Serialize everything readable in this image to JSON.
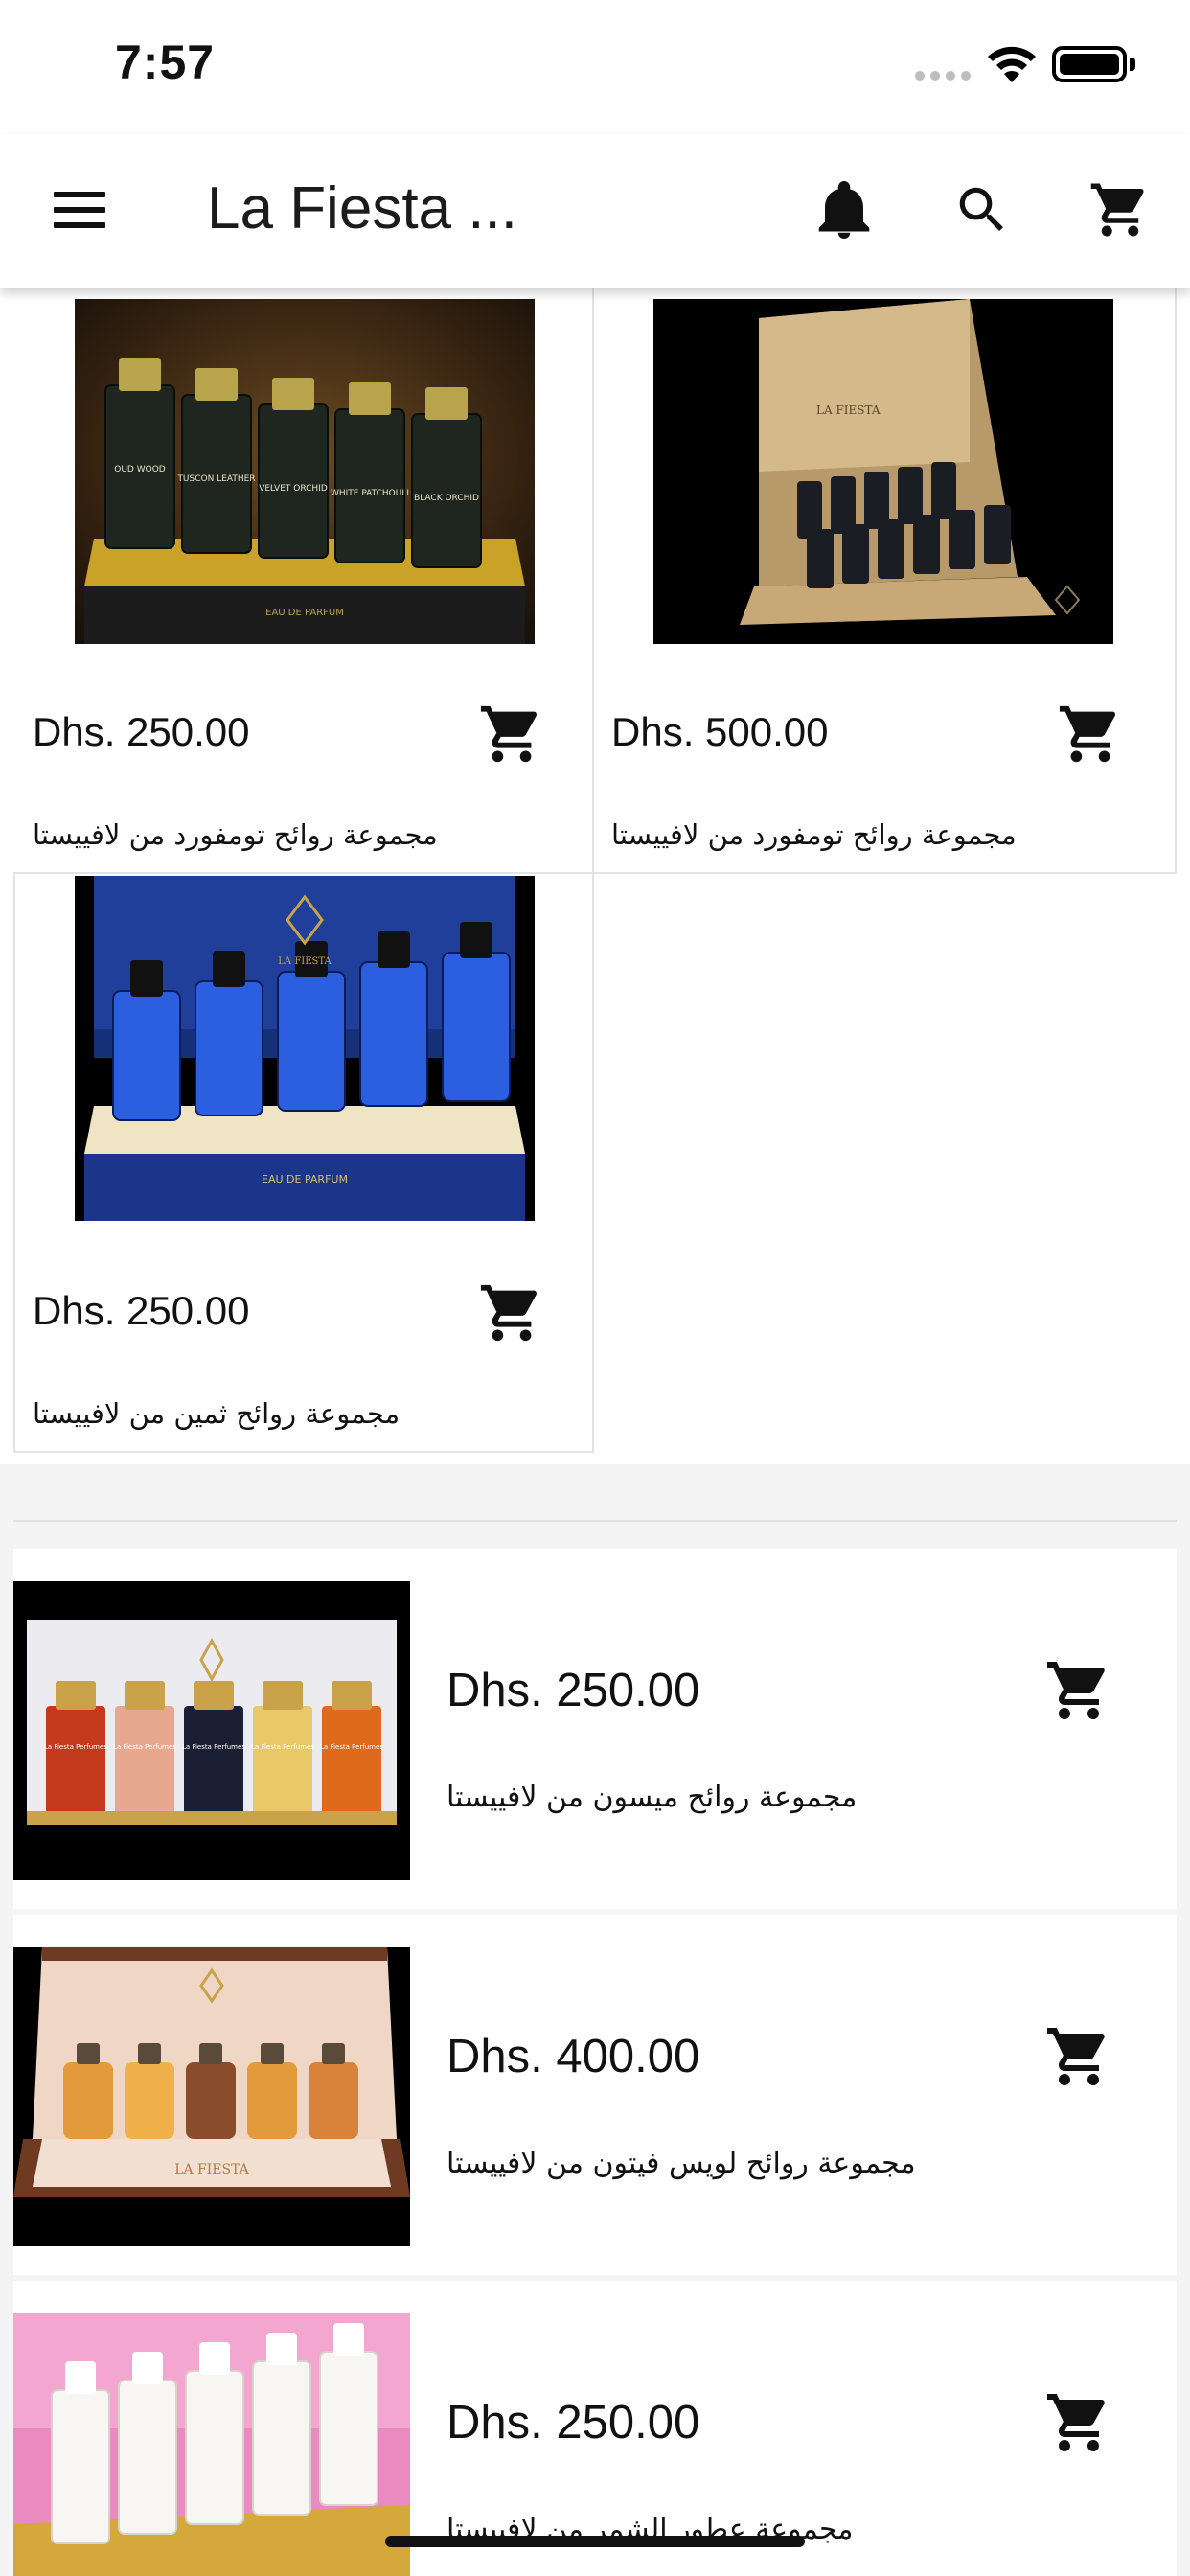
{
  "status_bar": {
    "time": "7:57"
  },
  "app_bar": {
    "title": "La Fiesta ..."
  },
  "grid_products": [
    {
      "price": "Dhs. 250.00",
      "name": "مجموعة روائح تومفورد من لافييستا",
      "bottle_labels": [
        "OUD WOOD",
        "TUSCON LEATHER",
        "VELVET ORCHID",
        "WHITE PATCHOULI",
        "BLACK ORCHID"
      ],
      "box_text": "EAU DE PARFUM"
    },
    {
      "price": "Dhs. 500.00",
      "name": "مجموعة روائح تومفورد من لافييستا",
      "brand_mark": "LA FIESTA"
    },
    {
      "price": "Dhs. 250.00",
      "name": "مجموعة روائح ثمين من لافييستا",
      "brand_mark": "LA FIESTA",
      "box_text": "EAU DE PARFUM"
    }
  ],
  "list_products": [
    {
      "price": "Dhs. 250.00",
      "name": "مجموعة روائح ميسون من لافييستا",
      "bottle_labels": [
        "La Fiesta Perfumes",
        "La Fiesta Perfumes",
        "La Fiesta Perfumes",
        "La Fiesta Perfumes",
        "La Fiesta Perfumes"
      ]
    },
    {
      "price": "Dhs. 400.00",
      "name": "مجموعة روائح لويس فيتون من لافييستا",
      "brand_mark": "LA FIESTA"
    },
    {
      "price": "Dhs. 250.00",
      "name": "مجموعة عطور الشمر من لافييستا"
    }
  ],
  "colors": {
    "accent": "#111111",
    "background": "#f4f4f4",
    "card": "#ffffff"
  },
  "icons": [
    "menu-icon",
    "bell-icon",
    "search-icon",
    "cart-icon",
    "wifi-icon",
    "battery-icon"
  ]
}
